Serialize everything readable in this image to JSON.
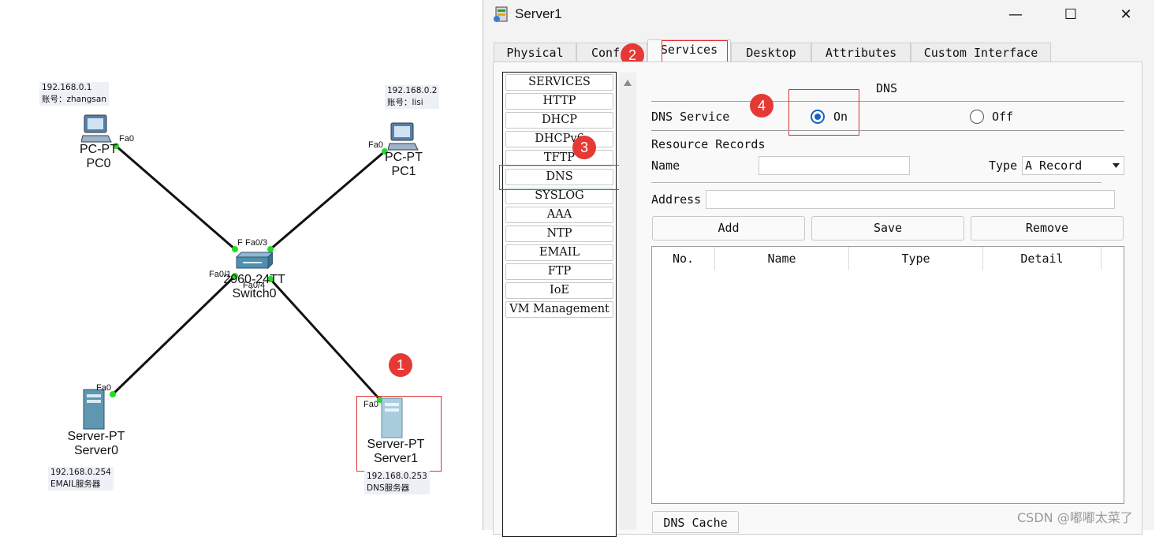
{
  "topology": {
    "pc0": {
      "model": "PC-PT",
      "name": "PC0",
      "port": "Fa0",
      "ip": "192.168.0.1",
      "account": "账号：zhangsan"
    },
    "pc1": {
      "model": "PC-PT",
      "name": "PC1",
      "port": "Fa0",
      "ip": "192.168.0.2",
      "account": "账号：lisi"
    },
    "switch": {
      "model": "2960-24TT",
      "name": "Switch0",
      "ports": {
        "fa03": "Fa0/3",
        "fa02": "F",
        "fa01": "Fa0/1",
        "fa04": "Fa0/4"
      }
    },
    "server0": {
      "model": "Server-PT",
      "name": "Server0",
      "port": "Fa0",
      "ip": "192.168.0.254",
      "role": "EMAIL服务器"
    },
    "server1": {
      "model": "Server-PT",
      "name": "Server1",
      "port": "Fa0",
      "ip": "192.168.0.253",
      "role": "DNS服务器"
    },
    "link_color": "#111111",
    "port_dot_color": "#22dd22"
  },
  "badges": [
    "1",
    "2",
    "3",
    "4"
  ],
  "window": {
    "title": "Server1",
    "controls": {
      "minimize": "—",
      "maximize": "☐",
      "close": "✕"
    },
    "tabs": [
      "Physical",
      "Conf",
      "Services",
      "Desktop",
      "Attributes",
      "Custom Interface"
    ],
    "active_tab": "Services",
    "services": [
      "SERVICES",
      "HTTP",
      "DHCP",
      "DHCPv6",
      "TFTP",
      "DNS",
      "SYSLOG",
      "AAA",
      "NTP",
      "EMAIL",
      "FTP",
      "IoE",
      "VM Management"
    ],
    "selected_service": "DNS",
    "dns": {
      "heading": "DNS",
      "service_label": "DNS Service",
      "on_label": "On",
      "off_label": "Off",
      "service_state": "on",
      "resource_records_label": "Resource Records",
      "name_label": "Name",
      "name_value": "",
      "type_label": "Type",
      "type_value": "A Record",
      "address_label": "Address",
      "address_value": "",
      "add_label": "Add",
      "save_label": "Save",
      "remove_label": "Remove",
      "columns": [
        "No.",
        "Name",
        "Type",
        "Detail"
      ],
      "rows": [],
      "cache_label": "DNS Cache"
    },
    "accent_color": "#1565c0"
  },
  "watermark": "CSDN @嘟嘟太菜了"
}
